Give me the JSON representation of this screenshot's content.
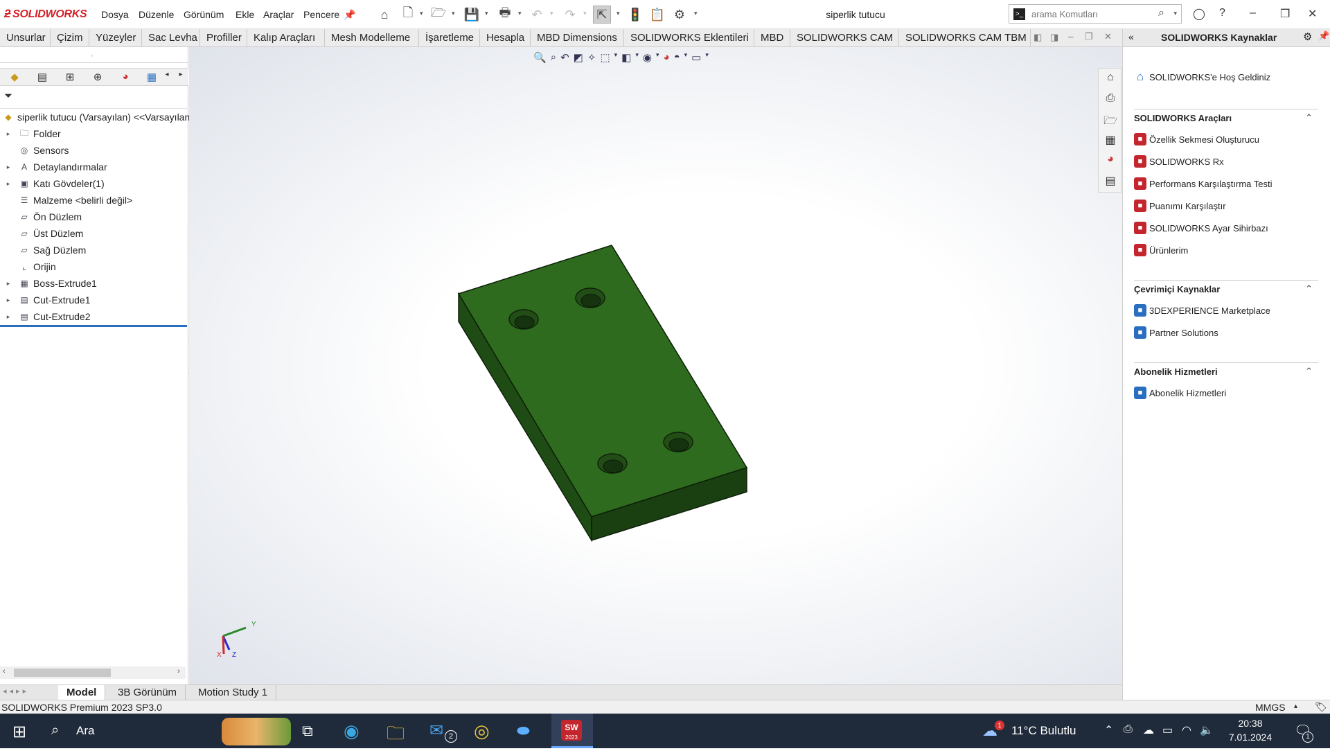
{
  "app": {
    "name": "SOLIDWORKS",
    "doc_title": "siperlik tutucu"
  },
  "menu": [
    "Dosya",
    "Düzenle",
    "Görünüm",
    "Ekle",
    "Araçlar",
    "Pencere"
  ],
  "search": {
    "placeholder": "arama Komutları"
  },
  "ribbon_tabs": [
    "Unsurlar",
    "Çizim",
    "Yüzeyler",
    "Sac Levha",
    "Profiller",
    "Kalıp Araçları",
    "Mesh Modelleme",
    "İşaretleme",
    "Hesapla",
    "MBD Dimensions",
    "SOLIDWORKS Eklentileri",
    "MBD",
    "SOLIDWORKS CAM",
    "SOLIDWORKS CAM TBM"
  ],
  "feature_tree": {
    "root": "siperlik tutucu  (Varsayılan) <<Varsayılan",
    "items": [
      {
        "label": "Folder",
        "expandable": true,
        "icon": "folder-icon"
      },
      {
        "label": "Sensors",
        "expandable": false,
        "icon": "sensor-icon"
      },
      {
        "label": "Detaylandırmalar",
        "expandable": true,
        "icon": "annotation-icon"
      },
      {
        "label": "Katı Gövdeler(1)",
        "expandable": true,
        "icon": "solid-bodies-icon"
      },
      {
        "label": "Malzeme <belirli değil>",
        "expandable": false,
        "icon": "material-icon"
      },
      {
        "label": "Ön Düzlem",
        "expandable": false,
        "icon": "plane-icon"
      },
      {
        "label": "Üst Düzlem",
        "expandable": false,
        "icon": "plane-icon"
      },
      {
        "label": "Sağ Düzlem",
        "expandable": false,
        "icon": "plane-icon"
      },
      {
        "label": "Orijin",
        "expandable": false,
        "icon": "origin-icon"
      },
      {
        "label": "Boss-Extrude1",
        "expandable": true,
        "icon": "extrude-icon"
      },
      {
        "label": "Cut-Extrude1",
        "expandable": true,
        "icon": "cut-icon"
      },
      {
        "label": "Cut-Extrude2",
        "expandable": true,
        "icon": "cut-icon"
      }
    ]
  },
  "triad": {
    "y": "Y",
    "x": "X",
    "z": "Z"
  },
  "bottom_tabs": [
    "Model",
    "3B Görünüm",
    "Motion Study 1"
  ],
  "status": {
    "version": "SOLIDWORKS Premium 2023 SP3.0",
    "units": "MMGS"
  },
  "resources_panel": {
    "title": "SOLIDWORKS Kaynaklar",
    "welcome": "SOLIDWORKS'e Hoş Geldiniz",
    "sections": [
      {
        "title": "SOLIDWORKS Araçları",
        "items": [
          "Özellik Sekmesi Oluşturucu",
          "SOLIDWORKS Rx",
          "Performans Karşılaştırma Testi",
          "Puanımı Karşılaştır",
          "SOLIDWORKS Ayar Sihirbazı",
          "Ürünlerim"
        ]
      },
      {
        "title": "Çevrimiçi Kaynaklar",
        "items": [
          "3DEXPERIENCE Marketplace",
          "Partner Solutions"
        ]
      },
      {
        "title": "Abonelik Hizmetleri",
        "items": [
          "Abonelik Hizmetleri"
        ]
      }
    ]
  },
  "taskbar": {
    "search": "Ara",
    "weather": "11°C  Bulutlu",
    "time": "20:38",
    "date": "7.01.2024",
    "mail_badge": "2",
    "notif_badge": "1",
    "weather_badge": "1",
    "sw_year": "2023"
  },
  "colors": {
    "part": "#2e6b1f",
    "accent": "#d2232a",
    "selection": "#2a6fbf"
  }
}
